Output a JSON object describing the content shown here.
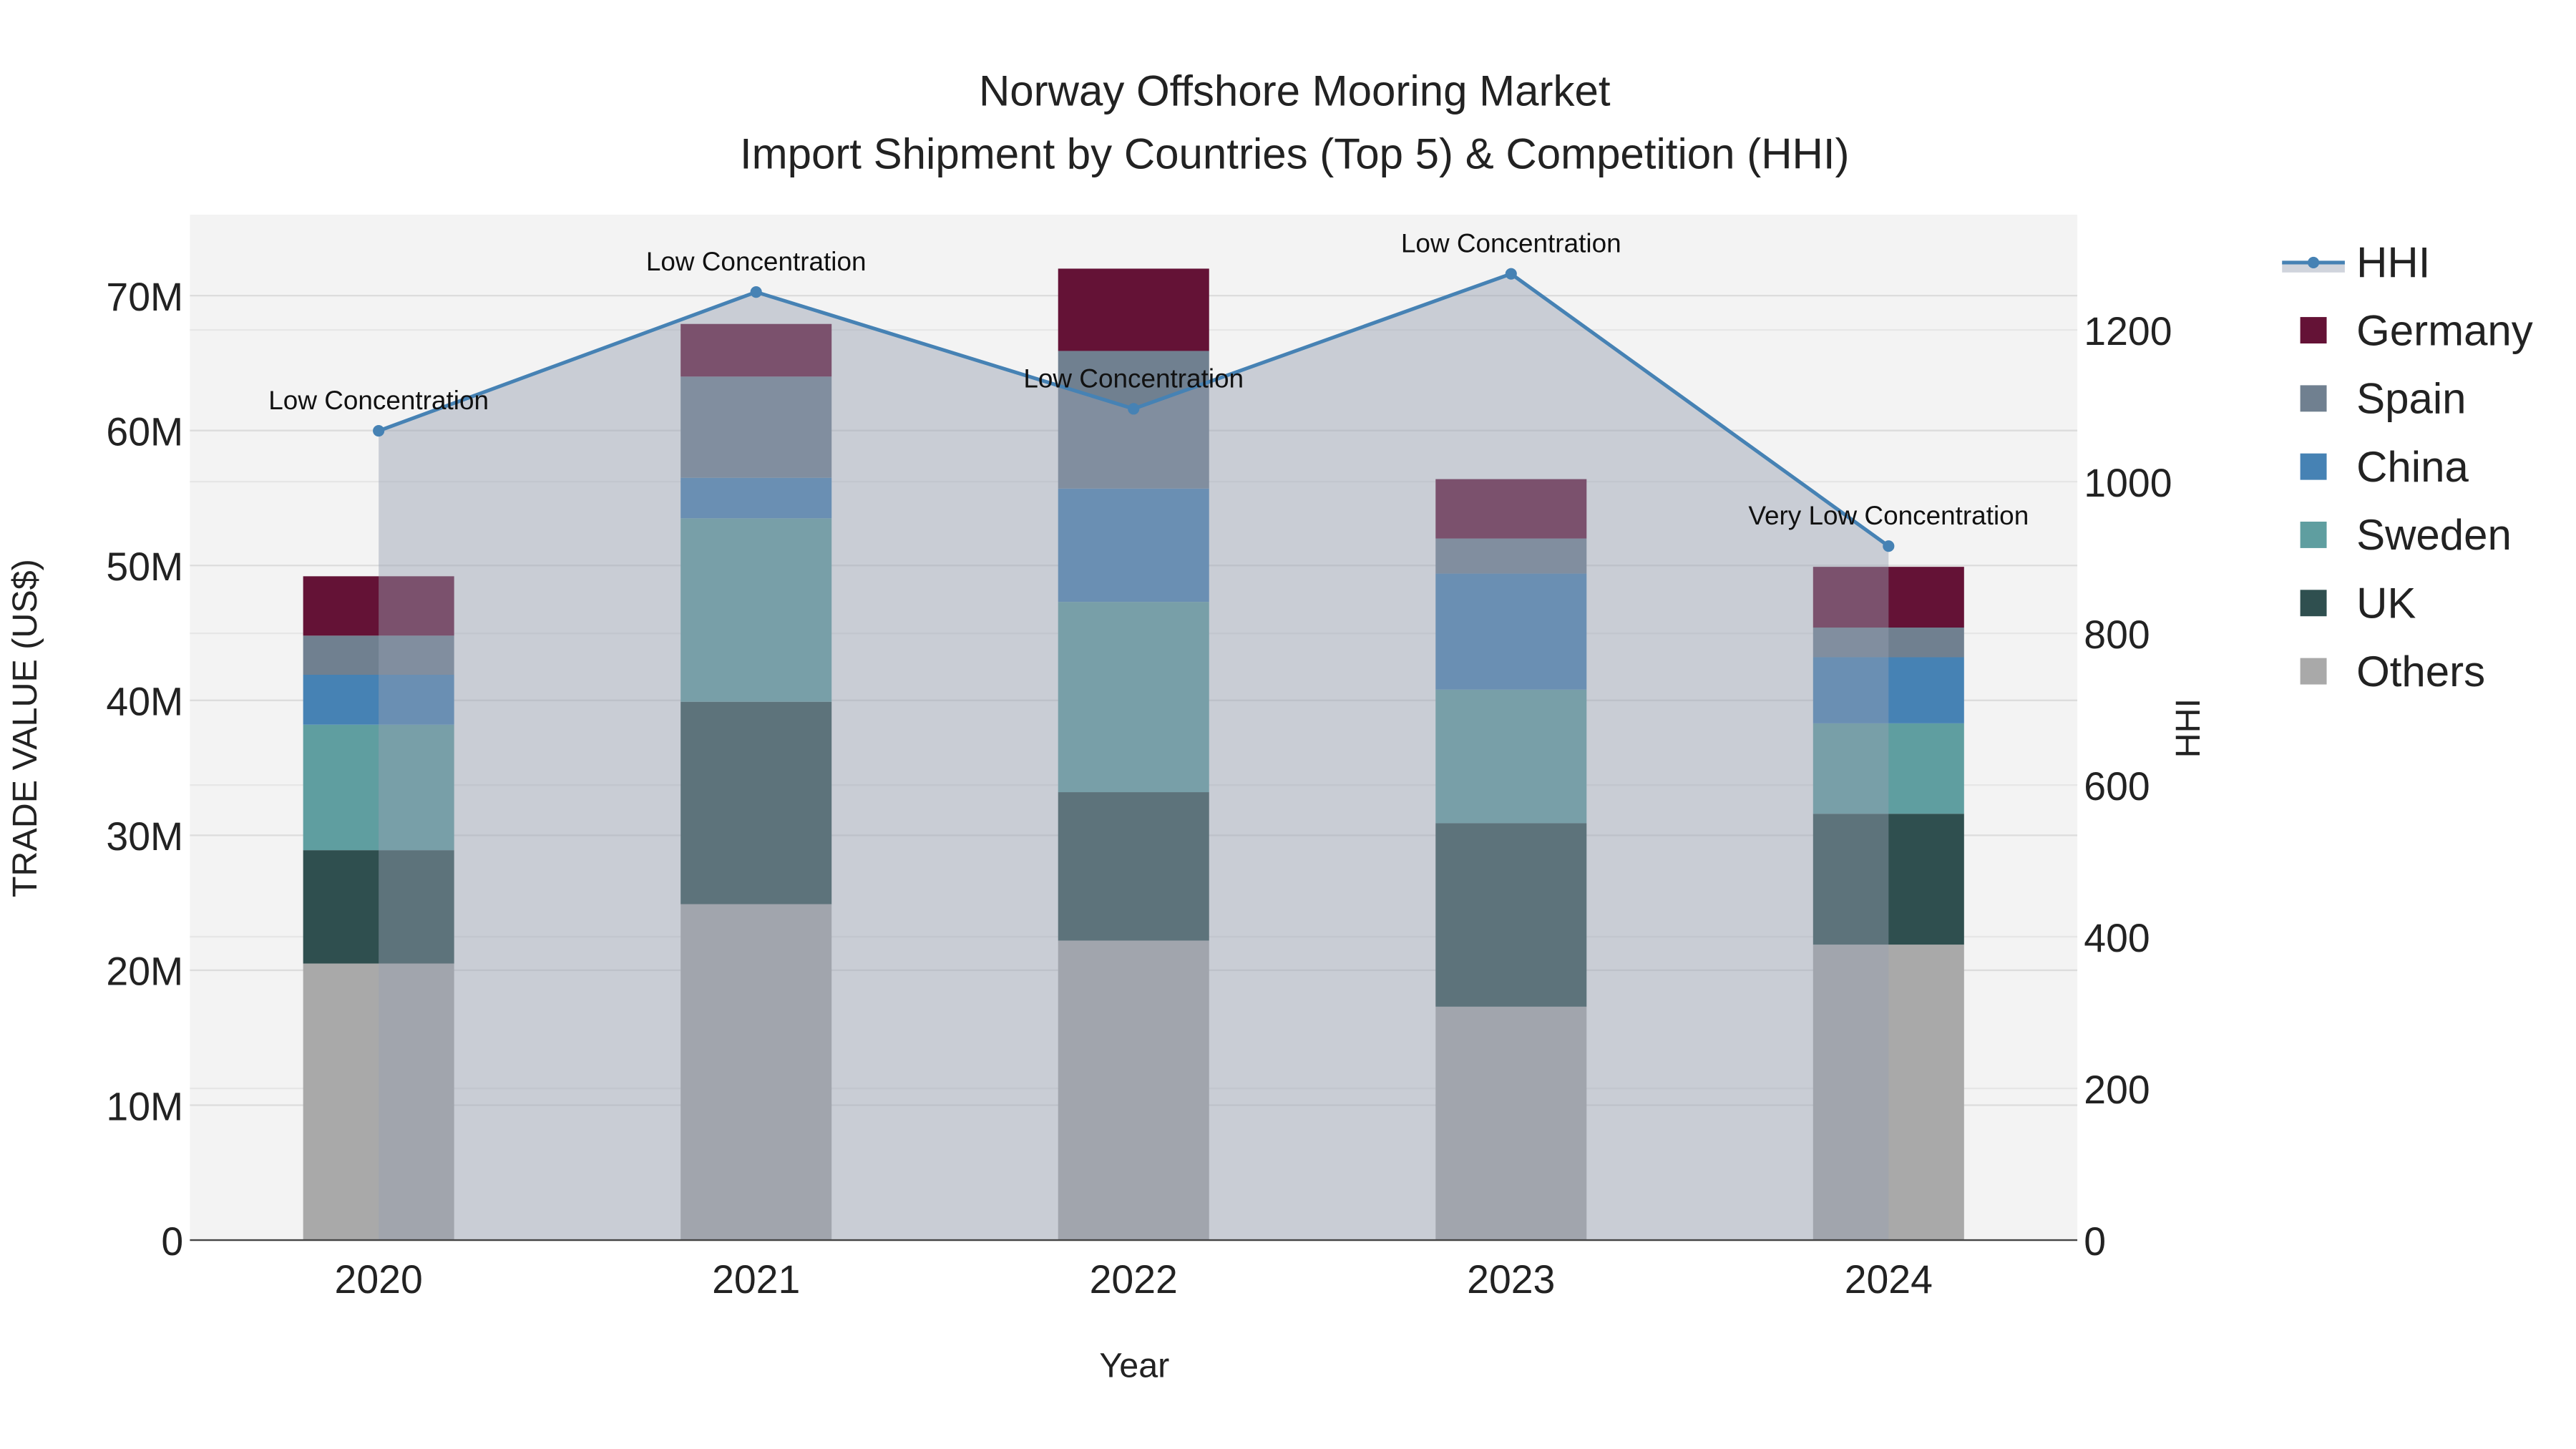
{
  "chart_data": {
    "type": "bar",
    "stacked": true,
    "title": "Norway Offshore Mooring Market",
    "subtitle": "Import Shipment by Countries (Top 5) & Competition (HHI)",
    "xlabel": "Year",
    "ylabel": "TRADE VALUE (US$)",
    "y2label": "HHI",
    "categories": [
      "2020",
      "2021",
      "2022",
      "2023",
      "2024"
    ],
    "ylim": [
      0,
      76000000
    ],
    "y2lim": [
      0,
      1352
    ],
    "yticks": [
      0,
      10000000,
      20000000,
      30000000,
      40000000,
      50000000,
      60000000,
      70000000
    ],
    "ytick_labels": [
      "0",
      "10M",
      "20M",
      "30M",
      "40M",
      "50M",
      "60M",
      "70M"
    ],
    "y2ticks": [
      0,
      200,
      400,
      600,
      800,
      1000,
      1200
    ],
    "y2tick_labels": [
      "0",
      "200",
      "400",
      "600",
      "800",
      "1000",
      "1200"
    ],
    "grid": true,
    "legend_position": "right",
    "series": [
      {
        "name": "Others",
        "color": "#a9a9a9",
        "values": [
          20500000,
          24900000,
          22200000,
          17300000,
          21900000
        ]
      },
      {
        "name": "UK",
        "color": "#2f4f4f",
        "values": [
          8400000,
          15000000,
          11000000,
          13600000,
          9700000
        ]
      },
      {
        "name": "Sweden",
        "color": "#5f9ea0",
        "values": [
          9300000,
          13600000,
          14100000,
          9900000,
          6700000
        ]
      },
      {
        "name": "China",
        "color": "#4682b4",
        "values": [
          3700000,
          3000000,
          8400000,
          8600000,
          4900000
        ]
      },
      {
        "name": "Spain",
        "color": "#708090",
        "values": [
          2900000,
          7500000,
          10200000,
          2600000,
          2200000
        ]
      },
      {
        "name": "Germany",
        "color": "#641236",
        "values": [
          4400000,
          3900000,
          6100000,
          4400000,
          4500000
        ]
      }
    ],
    "hhi": {
      "name": "HHI",
      "color": "#4682b4",
      "values": [
        1067,
        1250,
        1096,
        1274,
        915
      ],
      "annotations": [
        "Low Concentration",
        "Low Concentration",
        "Low Concentration",
        "Low Concentration",
        "Very Low Concentration"
      ]
    },
    "legend": [
      "HHI",
      "Germany",
      "Spain",
      "China",
      "Sweden",
      "UK",
      "Others"
    ]
  }
}
